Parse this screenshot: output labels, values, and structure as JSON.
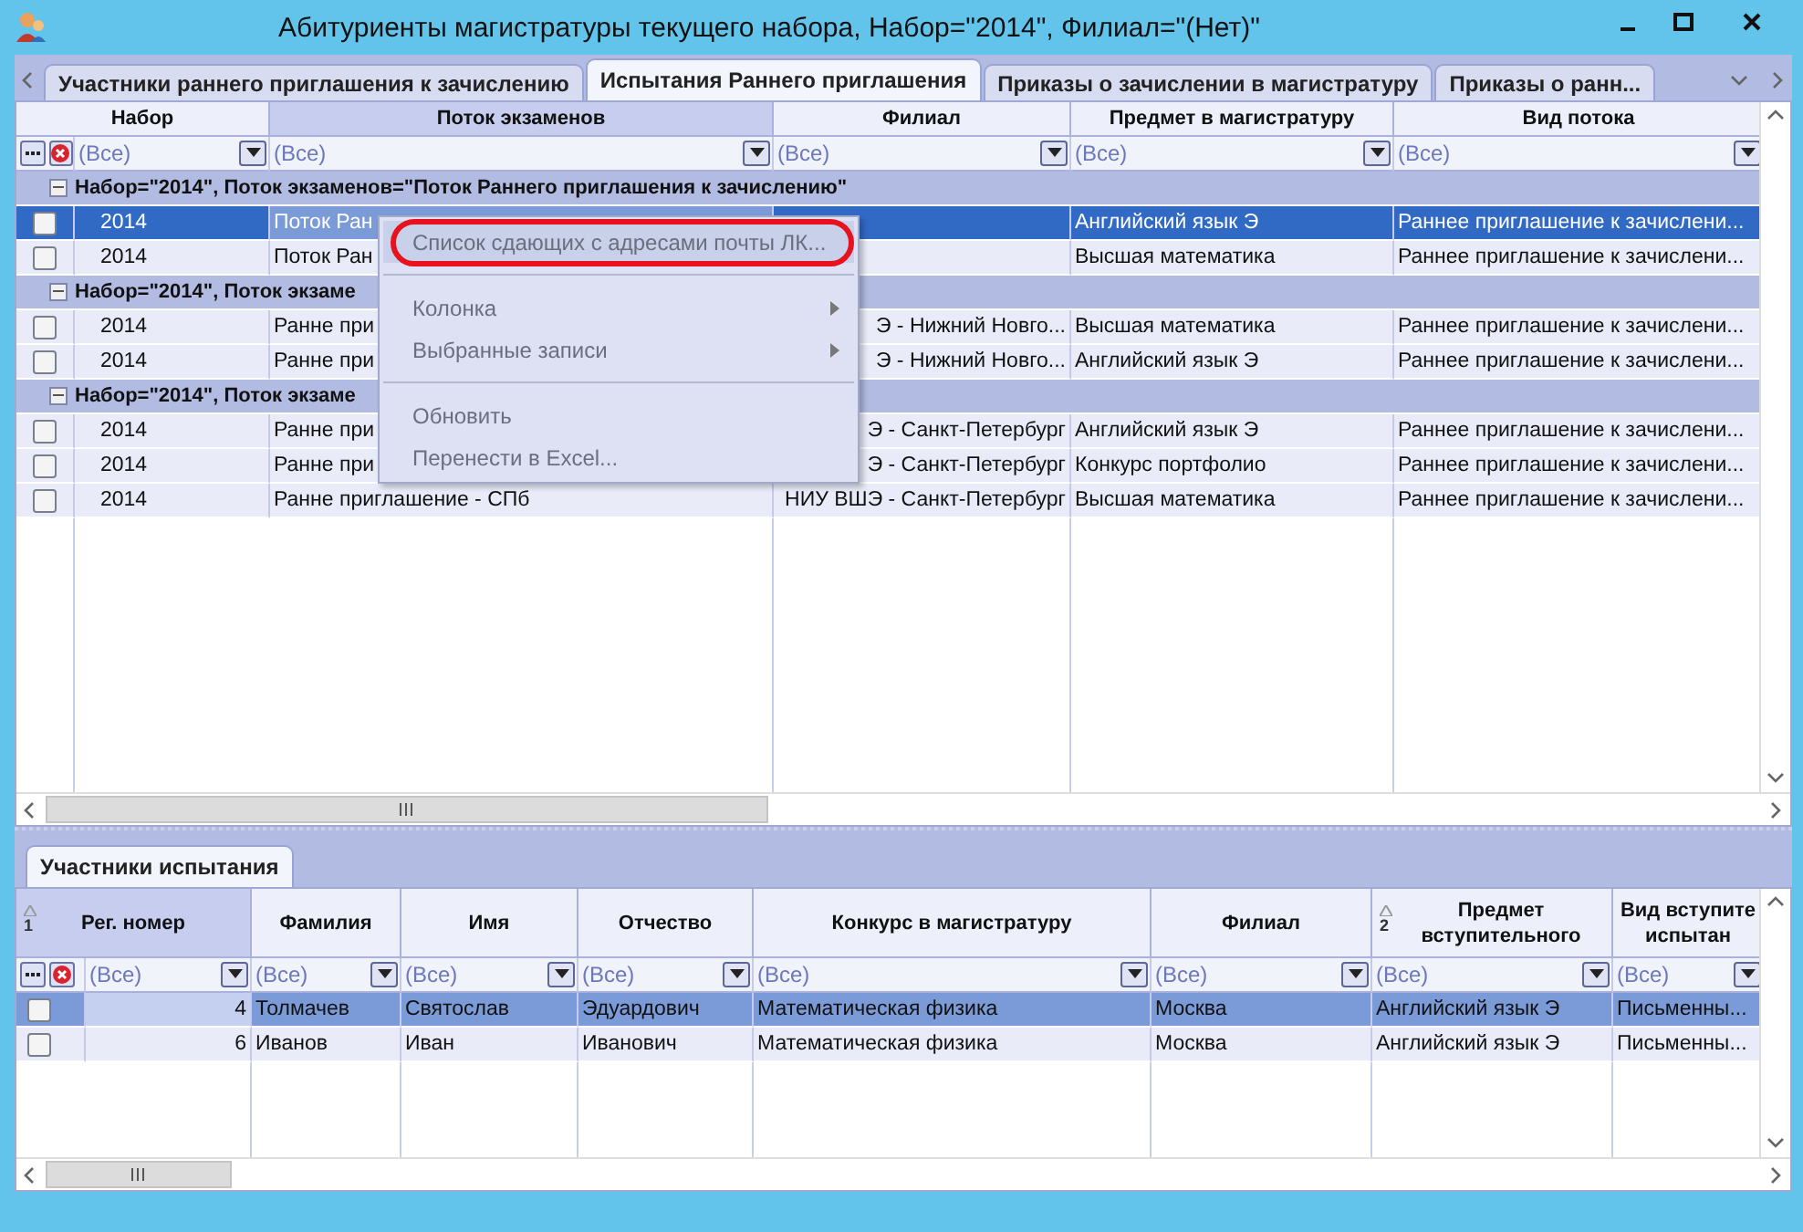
{
  "window": {
    "title": "Абитуриенты магистратуры текущего набора, Набор=\"2014\", Филиал=\"(Нет)\""
  },
  "tabs": [
    {
      "label": "Участники раннего приглашения к зачислению",
      "selected": false
    },
    {
      "label": "Испытания Раннего приглашения",
      "selected": true
    },
    {
      "label": "Приказы о зачислении в магистратуру",
      "selected": false
    },
    {
      "label": "Приказы о ранн...",
      "selected": false
    }
  ],
  "top_table": {
    "columns": [
      "Набор",
      "Поток экзаменов",
      "Филиал",
      "Предмет в магистратуру",
      "Вид потока"
    ],
    "filters": [
      "(Все)",
      "(Все)",
      "(Все)",
      "(Все)",
      "(Все)"
    ],
    "rows": [
      {
        "kind": "group",
        "expanded": true,
        "label": "Набор=\"2014\", Поток экзаменов=\"Поток Раннего приглашения к зачислению\""
      },
      {
        "kind": "record",
        "selected": true,
        "checked": false,
        "cells": [
          "2014",
          "Поток Ран",
          null,
          "Английский язык Э",
          "Раннее приглашение к зачислени..."
        ]
      },
      {
        "kind": "record",
        "selected": false,
        "checked": false,
        "cells": [
          "2014",
          "Поток Ран",
          null,
          "Высшая математика",
          "Раннее приглашение к зачислени..."
        ]
      },
      {
        "kind": "group",
        "expanded": true,
        "label": "Набор=\"2014\", Поток экзаме"
      },
      {
        "kind": "record",
        "selected": false,
        "checked": false,
        "cells": [
          "2014",
          "Ранне при",
          "Э - Нижний Новго...",
          "Высшая математика",
          "Раннее приглашение к зачислени..."
        ]
      },
      {
        "kind": "record",
        "selected": false,
        "checked": false,
        "cells": [
          "2014",
          "Ранне при",
          "Э - Нижний Новго...",
          "Английский язык Э",
          "Раннее приглашение к зачислени..."
        ]
      },
      {
        "kind": "group",
        "expanded": true,
        "label": "Набор=\"2014\", Поток экзаме"
      },
      {
        "kind": "record",
        "selected": false,
        "checked": false,
        "cells": [
          "2014",
          "Ранне при",
          "Э - Санкт-Петербург",
          "Английский язык Э",
          "Раннее приглашение к зачислени..."
        ]
      },
      {
        "kind": "record",
        "selected": false,
        "checked": false,
        "cells": [
          "2014",
          "Ранне при",
          "Э - Санкт-Петербург",
          "Конкурс портфолио",
          "Раннее приглашение к зачислени..."
        ]
      },
      {
        "kind": "record",
        "selected": false,
        "checked": false,
        "cells": [
          "2014",
          "Ранне приглашение - СПб",
          "НИУ ВШЭ - Санкт-Петербург",
          "Высшая математика",
          "Раннее приглашение к зачислени..."
        ]
      }
    ]
  },
  "context_menu": {
    "items": [
      {
        "kind": "item",
        "label": "Список сдающих с адресами почты ЛК...",
        "selected": true,
        "submenu": false,
        "circled": true
      },
      {
        "kind": "separator"
      },
      {
        "kind": "item",
        "label": "Колонка",
        "selected": false,
        "submenu": true,
        "circled": false
      },
      {
        "kind": "item",
        "label": "Выбранные записи",
        "selected": false,
        "submenu": true,
        "circled": false
      },
      {
        "kind": "separator"
      },
      {
        "kind": "item",
        "label": "Обновить",
        "selected": false,
        "submenu": false,
        "circled": false
      },
      {
        "kind": "item",
        "label": "Перенести в Excel...",
        "selected": false,
        "submenu": false,
        "circled": false
      }
    ]
  },
  "bottom_tabs": [
    {
      "label": "Участники испытания",
      "selected": true
    }
  ],
  "bottom_table": {
    "columns": [
      {
        "lines": [
          "Рег. номер"
        ],
        "sort": "1"
      },
      {
        "lines": [
          "Фамилия"
        ]
      },
      {
        "lines": [
          "Имя"
        ]
      },
      {
        "lines": [
          "Отчество"
        ]
      },
      {
        "lines": [
          "Конкурс в магистратуру"
        ]
      },
      {
        "lines": [
          "Филиал"
        ]
      },
      {
        "lines": [
          "Предмет",
          "вступительного"
        ],
        "sort": "2"
      },
      {
        "lines": [
          "Вид вступите",
          "испытан"
        ]
      }
    ],
    "filters": [
      "(Все)",
      "(Все)",
      "(Все)",
      "(Все)",
      "(Все)",
      "(Все)",
      "(Все)",
      "(Все)"
    ],
    "rows": [
      {
        "selected": true,
        "checked": false,
        "cells": [
          "4",
          "Толмачев",
          "Святослав",
          "Эдуардович",
          "Математическая физика",
          "Москва",
          "Английский язык Э",
          "Письменны..."
        ]
      },
      {
        "selected": false,
        "checked": false,
        "cells": [
          "6",
          "Иванов",
          "Иван",
          "Иванович",
          "Математическая физика",
          "Москва",
          "Английский язык Э",
          "Письменны..."
        ]
      }
    ]
  }
}
